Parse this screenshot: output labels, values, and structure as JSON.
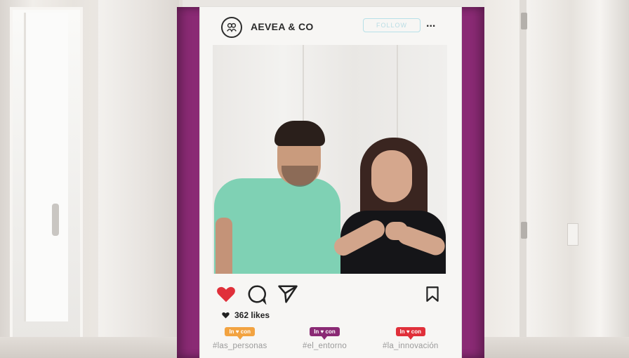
{
  "profile": {
    "name": "AEVEA & CO",
    "follow_label": "FOLLOW",
    "more": "..."
  },
  "post": {
    "likes_label": "362 likes",
    "tags": [
      {
        "badge": "In ♥ con",
        "hashtag": "#las_personas",
        "color": "#f2a341"
      },
      {
        "badge": "In ♥ con",
        "hashtag": "#el_entorno",
        "color": "#8a2a74"
      },
      {
        "badge": "In ♥ con",
        "hashtag": "#la_innovación",
        "color": "#e0303a"
      }
    ]
  },
  "icons": {
    "like": "heart-icon",
    "comment": "comment-icon",
    "share": "send-icon",
    "save": "bookmark-icon",
    "logo": "people-logo-icon"
  },
  "colors": {
    "frame_purple": "#8a2a74",
    "like_red": "#e0303a",
    "follow_outline": "#b7e0e8"
  }
}
